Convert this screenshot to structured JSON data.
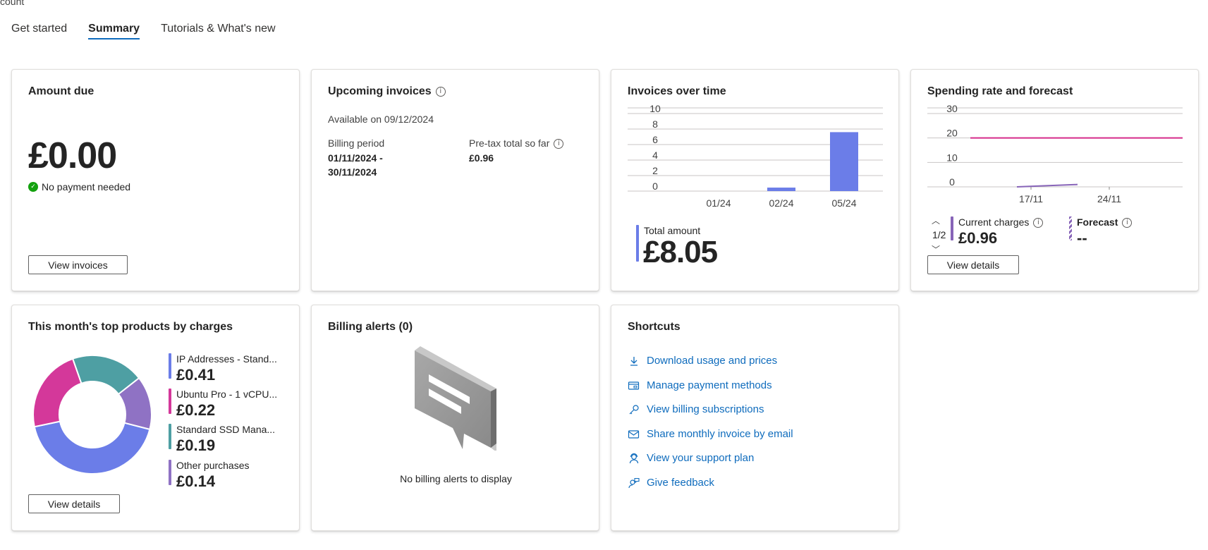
{
  "breadcrumb": "count",
  "tabs": [
    {
      "label": "Get started"
    },
    {
      "label": "Summary"
    },
    {
      "label": "Tutorials & What's new"
    }
  ],
  "amount_due": {
    "title": "Amount due",
    "amount": "£0.00",
    "status": "No payment needed",
    "button": "View invoices"
  },
  "upcoming": {
    "title": "Upcoming invoices",
    "available": "Available on 09/12/2024",
    "billing_period_label": "Billing period",
    "billing_period_line1": "01/11/2024 -",
    "billing_period_line2": "30/11/2024",
    "pretax_label": "Pre-tax total so far",
    "pretax_value": "£0.96"
  },
  "invoices_over_time": {
    "title": "Invoices over time",
    "total_label": "Total amount",
    "total_value": "£8.05",
    "colors": {
      "bar": "#6b7de8"
    }
  },
  "spending": {
    "title": "Spending rate and forecast",
    "pager": "1/2",
    "current_label": "Current charges",
    "current_value": "£0.96",
    "forecast_label": "Forecast",
    "forecast_value": "--",
    "button": "View details",
    "colors": {
      "budget_line": "#d52b8a",
      "current": "#8764b8"
    }
  },
  "top_products": {
    "title": "This month's top products by charges",
    "button": "View details",
    "items": [
      {
        "name": "IP Addresses - Stand...",
        "value": "£0.41",
        "color": "#6b7de8"
      },
      {
        "name": "Ubuntu Pro - 1 vCPU...",
        "value": "£0.22",
        "color": "#d4389a"
      },
      {
        "name": "Standard SSD Mana...",
        "value": "£0.19",
        "color": "#4e9fa3"
      },
      {
        "name": "Other purchases",
        "value": "£0.14",
        "color": "#8f72c4"
      }
    ]
  },
  "billing_alerts": {
    "title": "Billing alerts (0)",
    "empty": "No billing alerts to display"
  },
  "shortcuts": {
    "title": "Shortcuts",
    "items": [
      {
        "label": "Download usage and prices",
        "icon": "download-icon"
      },
      {
        "label": "Manage payment methods",
        "icon": "payment-card-icon"
      },
      {
        "label": "View billing subscriptions",
        "icon": "key-icon"
      },
      {
        "label": "Share monthly invoice by email",
        "icon": "mail-icon"
      },
      {
        "label": "View your support plan",
        "icon": "support-person-icon"
      },
      {
        "label": "Give feedback",
        "icon": "feedback-person-icon"
      }
    ]
  },
  "chart_data": [
    {
      "type": "bar",
      "title": "Invoices over time",
      "categories": [
        "01/24",
        "02/24",
        "05/24"
      ],
      "values": [
        0,
        0.45,
        7.6
      ],
      "yticks": [
        0,
        2,
        4,
        6,
        8,
        10
      ],
      "ylim": [
        0,
        10
      ]
    },
    {
      "type": "line",
      "title": "Spending rate and forecast",
      "xticks": [
        "17/11",
        "24/11"
      ],
      "yticks": [
        0,
        10,
        20,
        30
      ],
      "ylim": [
        0,
        30
      ],
      "series": [
        {
          "values": [
            20,
            20
          ]
        },
        {
          "name": "Current charges",
          "values": [
            0,
            0.96
          ]
        }
      ]
    },
    {
      "type": "pie",
      "title": "This month's top products by charges",
      "categories": [
        "IP Addresses - Stand...",
        "Ubuntu Pro - 1 vCPU...",
        "Standard SSD Mana...",
        "Other purchases"
      ],
      "values": [
        0.41,
        0.22,
        0.19,
        0.14
      ]
    }
  ]
}
